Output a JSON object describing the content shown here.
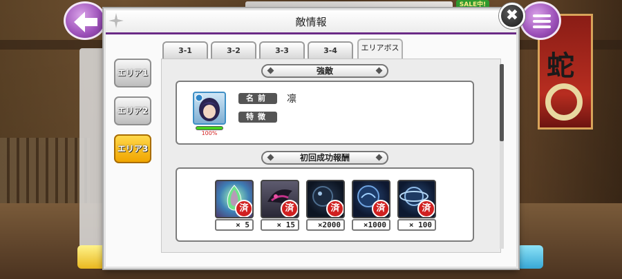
{
  "dialog": {
    "title": "敵情報",
    "close_glyph": "✖"
  },
  "area_buttons": [
    {
      "label": "エリア1",
      "active": false
    },
    {
      "label": "エリア2",
      "active": false
    },
    {
      "label": "エリア3",
      "active": true
    }
  ],
  "tabs": [
    {
      "label": "3-1",
      "active": false
    },
    {
      "label": "3-2",
      "active": false
    },
    {
      "label": "3-3",
      "active": false
    },
    {
      "label": "3-4",
      "active": false
    },
    {
      "label": "エリアボス",
      "active": true
    }
  ],
  "enemy_section": {
    "heading": "強敵",
    "name_label": "名前",
    "name_value": "凛",
    "trait_label": "特徴",
    "trait_value": "",
    "hp_percent_text": "100%",
    "hp_fraction": 1.0
  },
  "reward_section": {
    "heading": "初回成功報酬",
    "stamp_glyph": "済",
    "items": [
      {
        "icon": "rainbow-gem-icon",
        "quantity": "×    5"
      },
      {
        "icon": "dark-character-icon",
        "quantity": "×   15"
      },
      {
        "icon": "dark-orb-icon",
        "quantity": "×2000"
      },
      {
        "icon": "blue-orb-icon",
        "quantity": "×1000"
      },
      {
        "icon": "ring-orb-icon",
        "quantity": "×  100"
      }
    ]
  },
  "background": {
    "sale_badge": "SALE中!",
    "banner_char": "蛇"
  },
  "colors": {
    "accent": "#6a2a86",
    "active_area": "#f0a500",
    "stamp": "#d02020",
    "hp_bar": "#46d11e"
  }
}
